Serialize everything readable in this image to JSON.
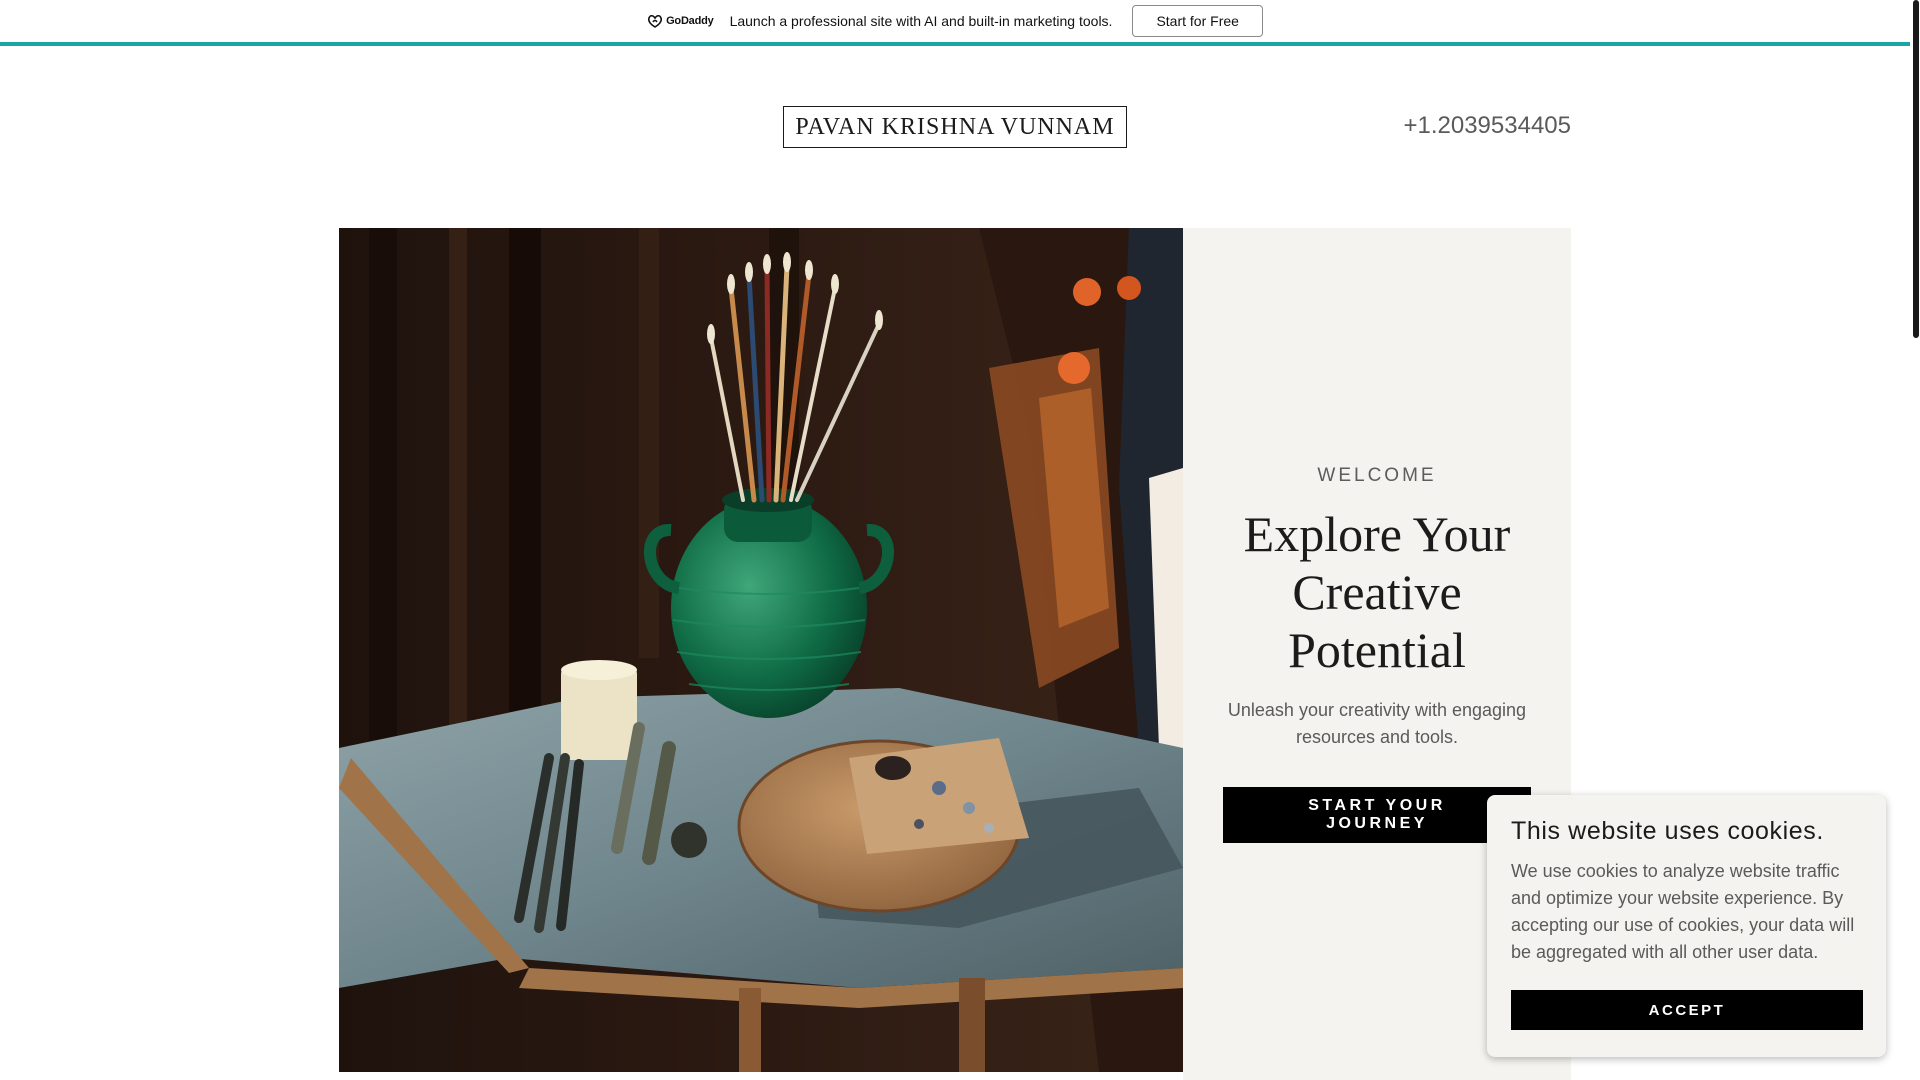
{
  "promo": {
    "logo_text": "GoDaddy",
    "message": "Launch a professional site with AI and built-in marketing tools.",
    "button_label": "Start for Free",
    "accent_color": "#1aa6a6"
  },
  "header": {
    "site_title": "PAVAN KRISHNA VUNNAM",
    "phone": "+1.2039534405"
  },
  "hero": {
    "image_icon": "painting-studio-photo",
    "eyebrow": "WELCOME",
    "headline": "Explore Your Creative Potential",
    "subtext": "Unleash your creativity with engaging resources and tools.",
    "cta_label": "START YOUR JOURNEY",
    "panel_color": "#f4f3ef"
  },
  "cookie_banner": {
    "title": "This website uses cookies.",
    "body": "We use cookies to analyze website traffic and optimize your website experience. By accepting our use of cookies, your data will be aggregated with all other user data.",
    "accept_label": "ACCEPT"
  }
}
